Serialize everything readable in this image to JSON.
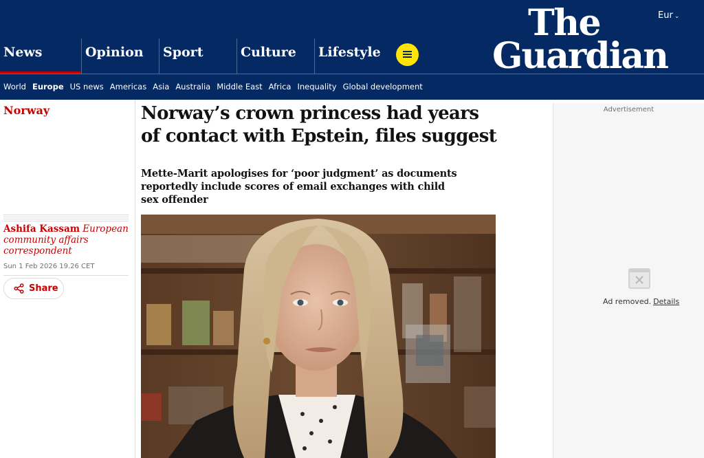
{
  "header": {
    "edition": "Eur",
    "logo_line1": "The",
    "logo_line2": "Guardian",
    "pillars": [
      "News",
      "Opinion",
      "Sport",
      "Culture",
      "Lifestyle"
    ],
    "active_pillar": "News",
    "subnav": [
      "World",
      "Europe",
      "US news",
      "Americas",
      "Asia",
      "Australia",
      "Middle East",
      "Africa",
      "Inequality",
      "Global development"
    ],
    "active_subnav": "Europe",
    "colors": {
      "brand": "#052962",
      "pillar_accent": "#c70000",
      "menu_button": "#ffe500"
    }
  },
  "article": {
    "section": "Norway",
    "author_name": "Ashifa Kassam",
    "author_role": "European community affairs correspondent",
    "date": "Sun 1 Feb 2026 19.26 CET",
    "share_label": "Share",
    "headline": "Norway’s crown princess had years of contact with Epstein, files suggest",
    "standfirst": "Mette-Marit apologises for ‘poor judgment’ as documents reportedly include scores of email exchanges with child sex offender",
    "image_icon": "photo-portrait"
  },
  "ad": {
    "label": "Advertisement",
    "removed_text": "Ad removed.",
    "details_link": "Details",
    "icon": "broken-ad-icon"
  }
}
